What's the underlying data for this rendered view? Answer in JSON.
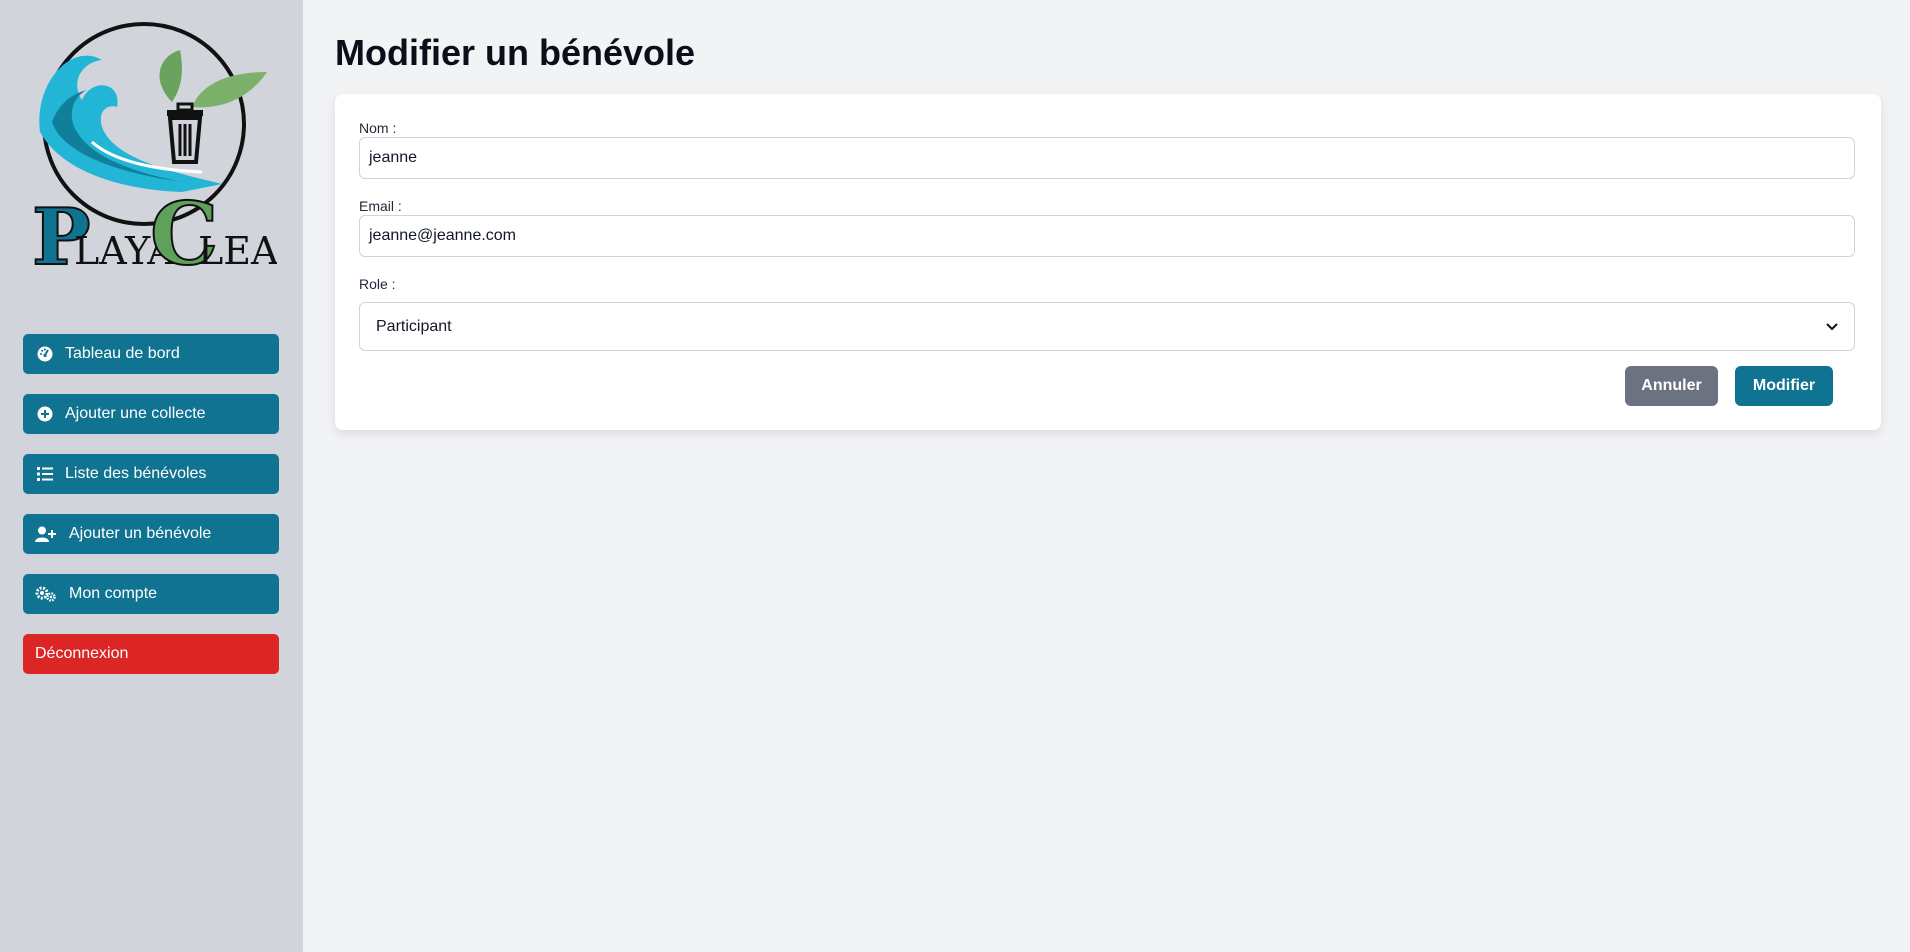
{
  "brand": {
    "logo_text": "PlayaClean"
  },
  "sidebar": {
    "items": [
      {
        "label": "Tableau de bord",
        "icon": "dashboard-gauge-icon"
      },
      {
        "label": "Ajouter une collecte",
        "icon": "plus-circle-icon"
      },
      {
        "label": "Liste des bénévoles",
        "icon": "list-icon"
      },
      {
        "label": "Ajouter un bénévole",
        "icon": "user-plus-icon"
      },
      {
        "label": "Mon compte",
        "icon": "gears-icon"
      },
      {
        "label": "Déconnexion",
        "icon": null
      }
    ]
  },
  "page": {
    "title": "Modifier un bénévole"
  },
  "form": {
    "name": {
      "label": "Nom :",
      "value": "jeanne"
    },
    "email": {
      "label": "Email :",
      "value": "jeanne@jeanne.com"
    },
    "role": {
      "label": "Role :",
      "value": "Participant"
    },
    "cancel_label": "Annuler",
    "submit_label": "Modifier"
  },
  "colors": {
    "primary": "#0f7391",
    "danger": "#dc2626",
    "cancel": "#6b7280",
    "sidebar_bg": "#d1d5db",
    "page_bg": "#f2f3f5"
  }
}
